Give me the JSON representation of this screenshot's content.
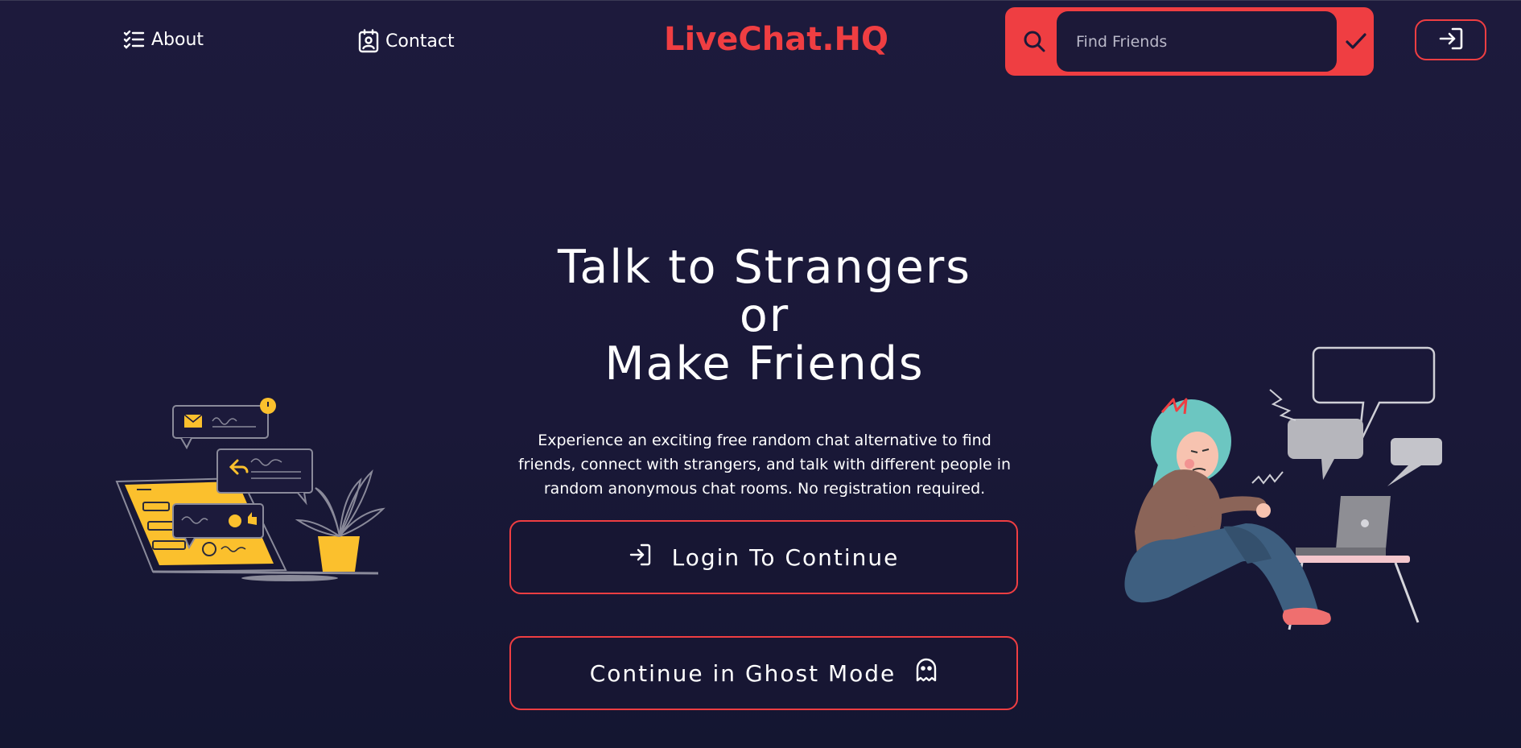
{
  "header": {
    "about_label": "About",
    "contact_label": "Contact",
    "brand": "LiveChat.HQ",
    "search_placeholder": "Find Friends",
    "search_value": ""
  },
  "hero": {
    "title_lines": [
      "Talk to Strangers",
      "or",
      "Make Friends"
    ],
    "description_lines": [
      "Experience an exciting free random chat alternative to find",
      "friends, connect with strangers, and talk with different people in",
      "random anonymous chat rooms. No registration required."
    ],
    "login_button_label": "Login To Continue",
    "ghost_button_label": "Continue in Ghost Mode"
  },
  "icons": {
    "about": "list-icon",
    "contact": "contact-card-icon",
    "search": "search-icon",
    "confirm": "check-icon",
    "login": "login-arrow-icon",
    "ghost": "ghost-icon"
  },
  "colors": {
    "accent": "#ef3e42",
    "background": "#1c1a3b",
    "illustration_yellow": "#fbc02d",
    "illustration_teal": "#6cc6c1"
  }
}
